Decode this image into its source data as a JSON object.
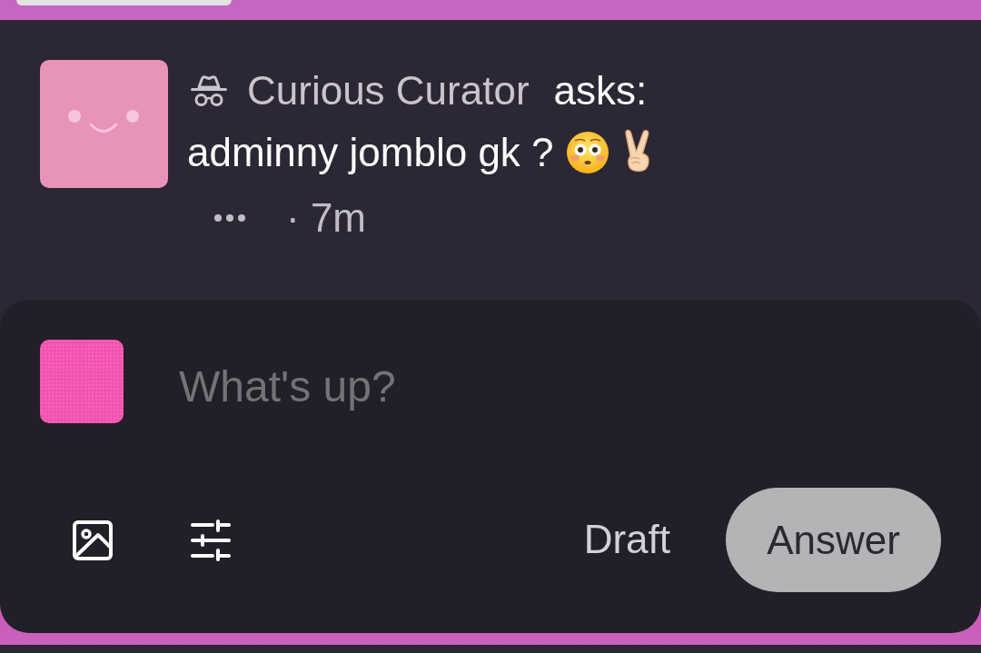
{
  "question": {
    "asker": {
      "name": "Curious Curator",
      "anonymous": true
    },
    "verb": "asks:",
    "text": "adminny jomblo gk ?",
    "time": "· 7m"
  },
  "composer": {
    "placeholder": "What's up?",
    "draft": "Draft",
    "answer": {
      "label": "Answer",
      "disabled": true
    }
  }
}
